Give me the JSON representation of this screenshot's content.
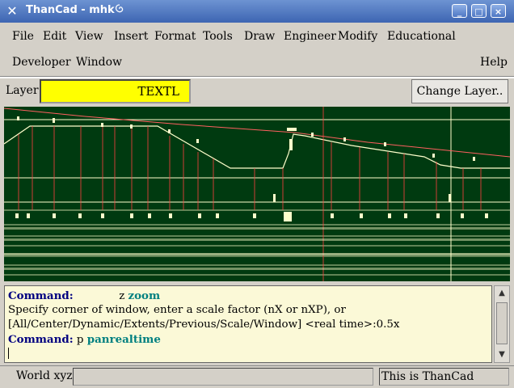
{
  "window": {
    "title": "ThanCad - mhk",
    "buttons": {
      "minimize": "_",
      "maximize": "□",
      "close": "×"
    }
  },
  "menu": {
    "row1": [
      "File",
      "Edit",
      "View",
      "Insert",
      "Format",
      "Tools",
      "Draw",
      "Engineer",
      "Modify",
      "Educational"
    ],
    "row2": [
      "Developer",
      "Window"
    ],
    "help": "Help"
  },
  "layer": {
    "label": "Layer:",
    "value": "TEXTL",
    "change_button": "Change Layer..",
    "field_color": "#ffff00"
  },
  "canvas": {
    "background": "#003a10",
    "line_color": "#ffffcc",
    "profile_color": "#ff6060"
  },
  "console": {
    "lines": [
      {
        "prompt": "Command:",
        "input": "z",
        "command": "zoom"
      },
      {
        "text": "Specify corner of window, enter a scale factor (nX or nXP), or"
      },
      {
        "text": "[All/Center/Dynamic/Extents/Previous/Scale/Window] <real time>:0.5x"
      },
      {
        "prompt": "Command:",
        "input": "p",
        "command": "panrealtime"
      }
    ]
  },
  "status": {
    "label": "World xyz:",
    "coords": "",
    "message": "This is ThanCad"
  }
}
